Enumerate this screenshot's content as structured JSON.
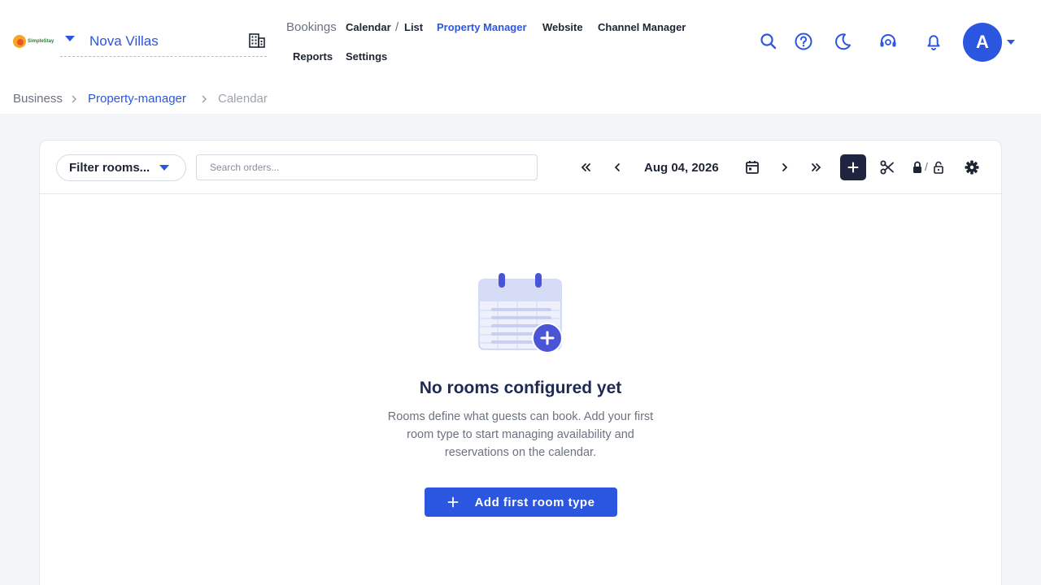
{
  "header": {
    "logo_text": "SimpleStay",
    "property_name": "Nova Villas",
    "nav": {
      "bookings": "Bookings",
      "calendar": "Calendar",
      "separator": "/",
      "list": "List",
      "property_manager": "Property Manager",
      "website": "Website",
      "channel_manager": "Channel Manager",
      "reports": "Reports",
      "settings": "Settings"
    },
    "avatar_initial": "A",
    "icons": [
      "search-icon",
      "help-icon",
      "moon-icon",
      "support-headset-icon",
      "bell-icon"
    ]
  },
  "breadcrumb": {
    "items": [
      "Business",
      "Property-manager",
      "Calendar"
    ]
  },
  "toolbar": {
    "filter_label": "Filter rooms...",
    "search_placeholder": "Search orders...",
    "date": "Aug 04, 2026",
    "lock_separator": "/"
  },
  "empty_state": {
    "title": "No rooms configured yet",
    "description": "Rooms define what guests can book. Add your first room type to start managing availability and reservations on the calendar.",
    "cta_label": "Add first room type"
  },
  "colors": {
    "accent": "#2b56e0",
    "dark_button": "#1f2540",
    "title": "#1e2a55",
    "illustration": "#d6dcf5",
    "illustration_accent": "#4a55d6"
  }
}
